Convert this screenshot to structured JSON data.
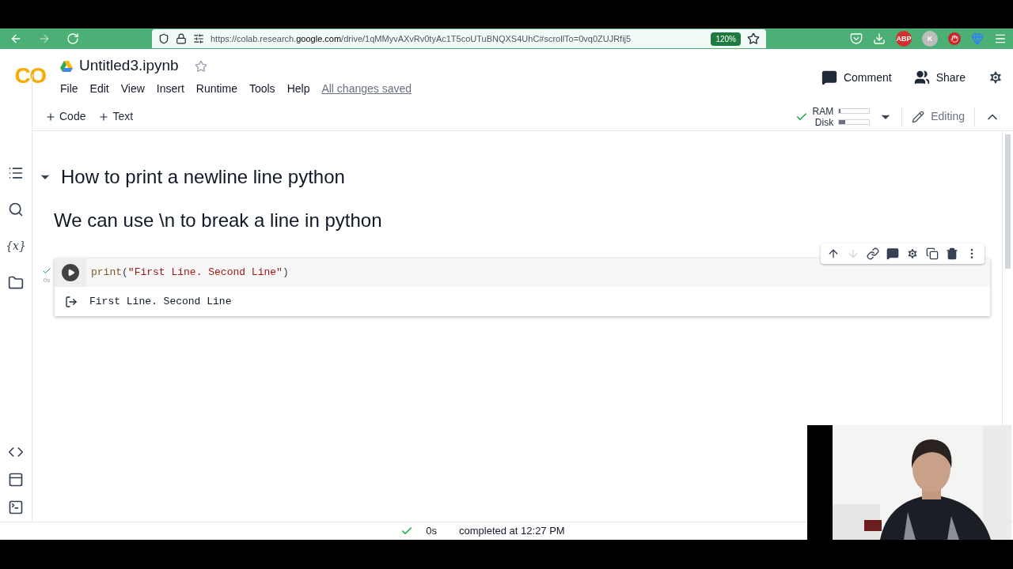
{
  "browser": {
    "url_prefix": "https://colab.research.",
    "url_domain": "google.com",
    "url_rest": "/drive/1qMMyvAXvRv0tyAc1T5coUTuBNQXS4UhC#scrollTo=0vq0ZUJRfij5",
    "zoom": "120%",
    "extensions": [
      {
        "kind": "pocket"
      },
      {
        "kind": "download"
      },
      {
        "kind": "badge",
        "label": "ABP",
        "color": "#d32f2f"
      },
      {
        "kind": "badge",
        "label": "K",
        "color": "#bdbdbd"
      },
      {
        "kind": "hand",
        "color": "#c62828"
      },
      {
        "kind": "gem"
      },
      {
        "kind": "menu"
      }
    ]
  },
  "header": {
    "logo": "CO",
    "title": "Untitled3.ipynb",
    "menu": [
      "File",
      "Edit",
      "View",
      "Insert",
      "Runtime",
      "Tools",
      "Help"
    ],
    "save_status": "All changes saved",
    "comment": "Comment",
    "share": "Share"
  },
  "toolbar": {
    "add": [
      "Code",
      "Text"
    ],
    "ram": {
      "label": "RAM",
      "level": 0.05
    },
    "disk": {
      "label": "Disk",
      "level": 0.2
    },
    "editing": "Editing"
  },
  "sidebar": [
    {
      "kind": "toc"
    },
    {
      "kind": "search"
    },
    {
      "kind": "variables",
      "label": "{x}"
    },
    {
      "kind": "files"
    }
  ],
  "sidebar_bottom": [
    {
      "kind": "snippets"
    },
    {
      "kind": "palette"
    },
    {
      "kind": "terminal"
    }
  ],
  "cells": [
    {
      "kind": "heading",
      "text": "How to print a newline line python",
      "expanded": true
    },
    {
      "kind": "markdown",
      "text": "We can use \\n to break a line in python"
    },
    {
      "kind": "code",
      "exec_time": "0s",
      "tokens": [
        {
          "kind": "builtin",
          "text": "print"
        },
        {
          "kind": "punct",
          "text": "("
        },
        {
          "kind": "string",
          "text": "\"First Line. Second Line\""
        },
        {
          "kind": "punct",
          "text": ")"
        }
      ],
      "output": "First Line. Second Line"
    }
  ],
  "status_bar": {
    "time": "0s",
    "message": "completed at 12:27 PM"
  }
}
